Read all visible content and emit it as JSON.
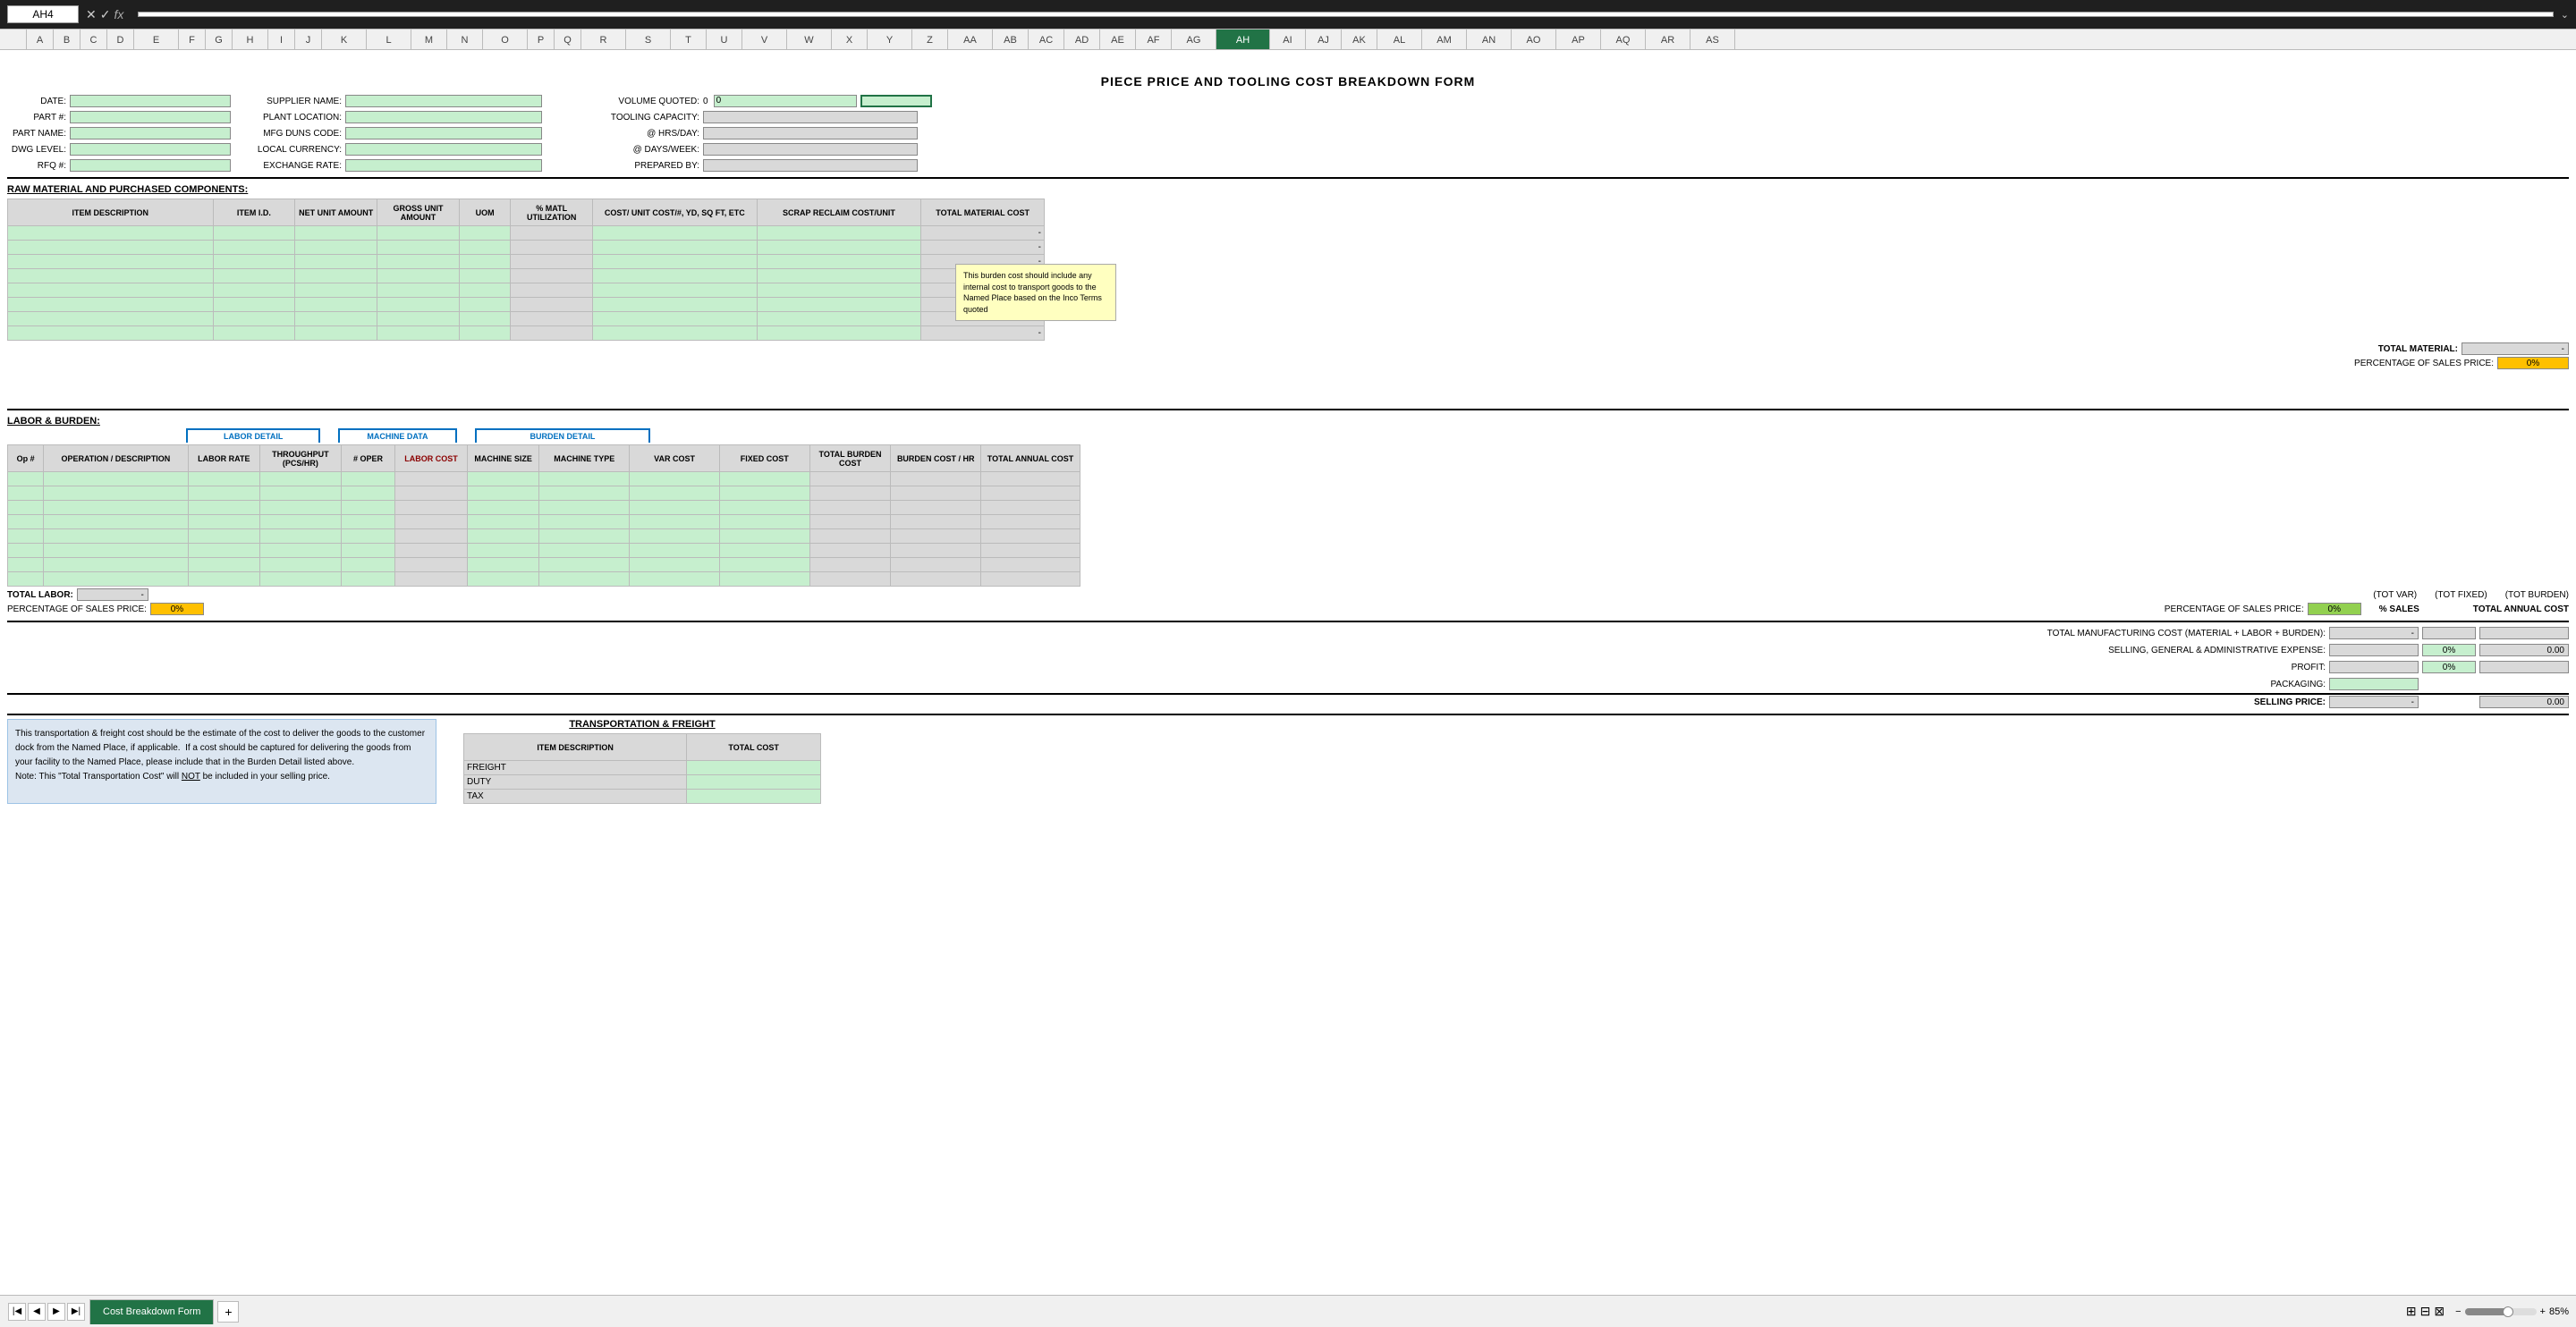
{
  "titleBar": {
    "cellRef": "AH4",
    "formula": "fx"
  },
  "columnHeaders": [
    "A",
    "B",
    "C",
    "D",
    "E",
    "F",
    "G",
    "H",
    "I",
    "J",
    "K",
    "L",
    "M",
    "N",
    "O",
    "P",
    "Q",
    "R",
    "S",
    "T",
    "U",
    "V",
    "W",
    "X",
    "Y",
    "Z",
    "AA",
    "AB",
    "AC",
    "AD",
    "AE",
    "AF",
    "AG",
    "AH",
    "AI",
    "AJ",
    "AK",
    "AL",
    "AM",
    "AN",
    "AO",
    "AP",
    "AQ",
    "AR",
    "AS"
  ],
  "formTitle": "PIECE PRICE AND TOOLING COST BREAKDOWN FORM",
  "infoFields": {
    "date_label": "DATE:",
    "partNum_label": "PART #:",
    "partName_label": "PART NAME:",
    "dwgLevel_label": "DWG LEVEL:",
    "rfqNum_label": "RFQ #:",
    "supplierName_label": "SUPPLIER NAME:",
    "plantLocation_label": "PLANT LOCATION:",
    "mfgDuns_label": "MFG DUNS CODE:",
    "localCurrency_label": "LOCAL CURRENCY:",
    "exchangeRate_label": "EXCHANGE RATE:",
    "volumeQuoted_label": "VOLUME QUOTED:",
    "volumeQuoted_value": "0",
    "toolingCapacity_label": "TOOLING CAPACITY:",
    "hrsPerDay_label": "@ HRS/DAY:",
    "daysPerWeek_label": "@ DAYS/WEEK:",
    "preparedBy_label": "PREPARED BY:",
    "field_0_value": "0"
  },
  "sections": {
    "rawMaterial": {
      "title": "RAW MATERIAL AND PURCHASED COMPONENTS:",
      "columns": [
        "ITEM DESCRIPTION",
        "ITEM I.D.",
        "NET UNIT AMOUNT",
        "GROSS UNIT AMOUNT",
        "UOM",
        "% MATL UTILIZATION",
        "COST/ UNIT COST/#, YD, SQ FT, ETC",
        "SCRAP RECLAIM COST/UNIT",
        "TOTAL MATERIAL COST"
      ],
      "totalMaterial_label": "TOTAL MATERIAL:",
      "percentSales_label": "PERCENTAGE OF SALES PRICE:",
      "percentSales_value": "0%"
    },
    "laborBurden": {
      "title": "LABOR & BURDEN:",
      "laborDetailLabel": "LABOR DETAIL",
      "machineDataLabel": "MACHINE DATA",
      "burdenDetailLabel": "BURDEN DETAIL",
      "columns": [
        "Op #",
        "OPERATION / DESCRIPTION",
        "LABOR RATE",
        "THROUGHPUT (PCS/HR)",
        "# OPER",
        "LABOR COST",
        "MACHINE SIZE",
        "MACHINE TYPE",
        "VAR COST",
        "FIXED COST",
        "TOTAL BURDEN COST",
        "BURDEN COST / HR",
        "TOTAL ANNUAL COST"
      ],
      "totalLabor_label": "TOTAL LABOR:",
      "totalLabor_value": "-",
      "percentSales_label": "PERCENTAGE OF SALES PRICE:",
      "percentSales_value": "0%",
      "totVar_label": "(TOT VAR)",
      "totFixed_label": "(TOT FIXED)",
      "totBurden_label": "(TOT BURDEN)",
      "percentSalesBurden_label": "PERCENTAGE OF SALES PRICE:",
      "percentSalesBurden_value": "0%",
      "percentSales_col": "% SALES",
      "totalAnnualCost_col": "TOTAL ANNUAL COST"
    },
    "summary": {
      "totalMfgCost_label": "TOTAL MANUFACTURING COST (MATERIAL + LABOR + BURDEN):",
      "totalMfgCost_value": "-",
      "sga_label": "SELLING, GENERAL & ADMINISTRATIVE EXPENSE:",
      "sga_pct": "0%",
      "sga_val": "0.00",
      "profit_label": "PROFIT:",
      "profit_pct": "0%",
      "profit_val": "",
      "packaging_label": "PACKAGING:",
      "packaging_val": "",
      "sellingPrice_label": "SELLING PRICE:",
      "sellingPrice_value": "-",
      "sellingPrice_total": "0.00"
    },
    "transportation": {
      "title": "TRANSPORTATION & FREIGHT",
      "columns": [
        "ITEM DESCRIPTION",
        "TOTAL COST"
      ],
      "rows": [
        "FREIGHT",
        "DUTY",
        "TAX"
      ]
    }
  },
  "tooltip": {
    "text": "This burden cost should include any internal cost to transport goods to the Named Place based on the Inco Terms quoted"
  },
  "transportNote": {
    "text": "This transportation & freight cost should be the estimate of the cost to deliver the goods to the customer dock from the Named Place, if applicable.  If a cost should be captured for delivering the goods from your facility to the Named Place, please include that in the Burden Detail listed above. Note: This \"Total Transportation Cost\" will NOT be included in your selling price.",
    "notUnderlined": "NOT"
  },
  "tabBar": {
    "sheetTab": "Cost Breakdown Form",
    "zoomLevel": "85%"
  },
  "icons": {
    "undo": "↩",
    "redo": "↪",
    "cross": "✕",
    "check": "✓",
    "arrowUp": "▲",
    "arrowDown": "▼",
    "arrowLeft": "◀",
    "arrowRight": "▶",
    "plus": "+",
    "minus": "−",
    "normal": "⊞",
    "pageLayout": "⊟",
    "pageBreak": "⊠",
    "zoomIn": "+",
    "zoomOut": "−"
  }
}
